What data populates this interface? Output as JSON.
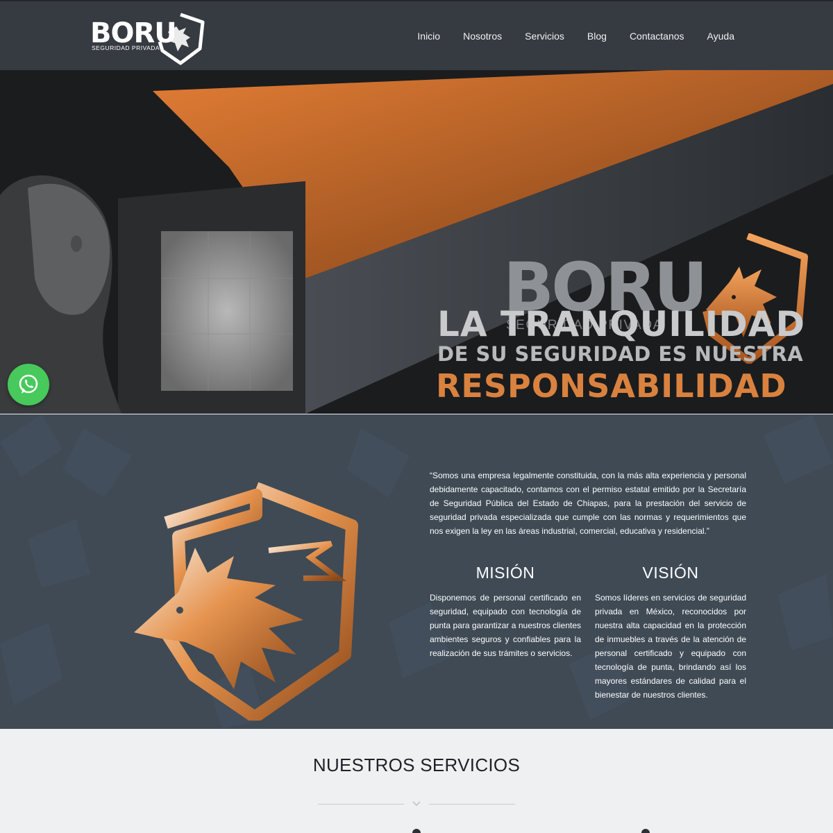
{
  "brand": {
    "name": "BORU",
    "tagline": "SEGURIDAD PRIVADA"
  },
  "nav": {
    "items": [
      "Inicio",
      "Nosotros",
      "Servicios",
      "Blog",
      "Contactanos",
      "Ayuda"
    ]
  },
  "hero": {
    "brand_name": "BORU",
    "brand_tagline": "SEGURIDAD PRIVADA",
    "line1": "LA TRANQUILIDAD",
    "line2": "DE SU SEGURIDAD ES NUESTRA",
    "line3": "RESPONSABILIDAD"
  },
  "about": {
    "quote": "“Somos una empresa legalmente constituida, con la más alta experiencia y personal debidamente capacitado, contamos con el permiso estatal emitido por la Secretaría de Seguridad Pública del Estado de Chiapas, para la prestación del servicio de seguridad privada especializada que cumple con las normas y requerimientos que nos exigen la ley en las áreas industrial, comercial, educativa y residencial.”",
    "mision": {
      "title": "MISIÓN",
      "text": "Disponemos de personal certificado en seguridad, equipado con tecnología de punta para garantizar a nuestros clientes ambientes seguros y confiables para la realización de sus trámites o servicios."
    },
    "vision": {
      "title": "VISIÓN",
      "text": "Somos líderes en servicios de seguridad privada en México, reconocidos por nuestra alta capacidad en la protección de inmuebles a través de la atención de personal certificado y equipado con tecnología de punta, brindando así los mayores estándares de calidad para el bienestar de nuestros clientes."
    }
  },
  "services": {
    "title": "NUESTROS SERVICIOS"
  },
  "colors": {
    "header_bg": "#363b42",
    "accent_orange": "#d9823f",
    "about_bg": "#3f4a55",
    "whatsapp_green": "#47c95b"
  },
  "icons": [
    "whatsapp-icon",
    "wolf-shield-icon",
    "chevron-down-icon"
  ]
}
